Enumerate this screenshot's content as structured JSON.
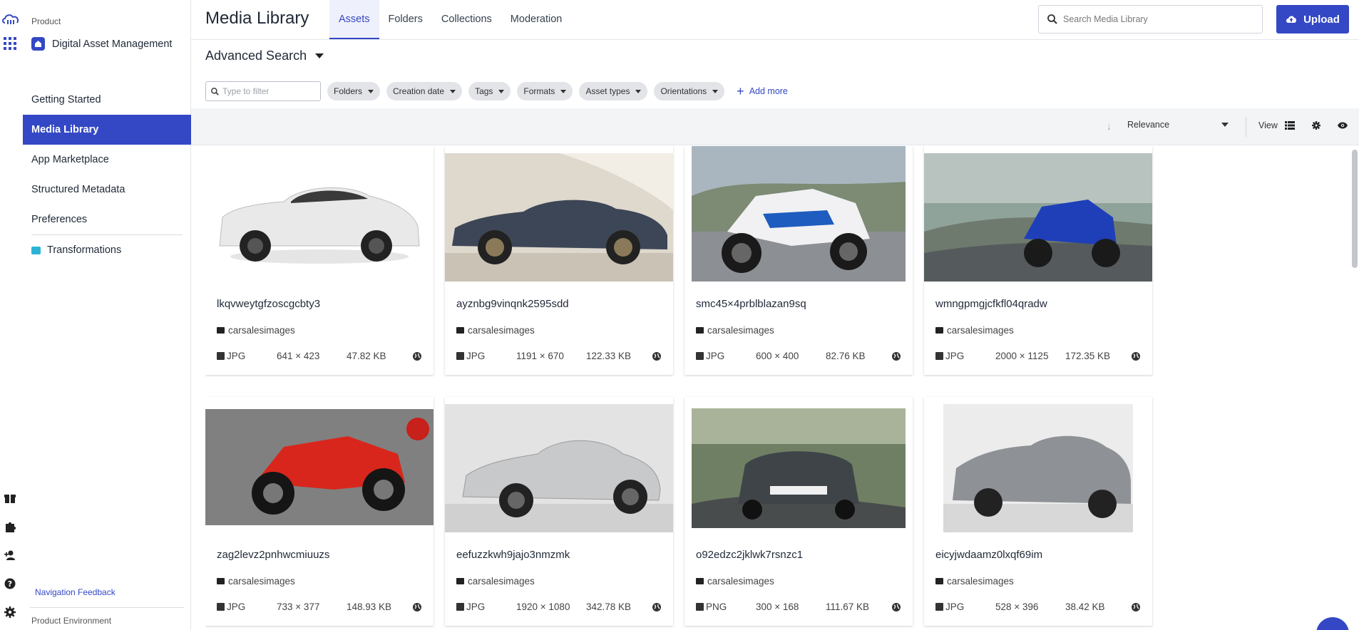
{
  "sidebar": {
    "product_label": "Product",
    "product_name": "Digital Asset Management",
    "nav": [
      "Getting Started",
      "Media Library",
      "App Marketplace",
      "Structured Metadata",
      "Preferences"
    ],
    "active_index": 1,
    "transformations": "Transformations",
    "feedback": "Navigation Feedback",
    "environment": "Product Environment"
  },
  "header": {
    "title": "Media Library",
    "tabs": [
      "Assets",
      "Folders",
      "Collections",
      "Moderation"
    ],
    "active_tab": 0,
    "search_placeholder": "Search Media Library",
    "upload_label": "Upload"
  },
  "search_bar": {
    "title": "Advanced Search",
    "filter_placeholder": "Type to filter",
    "chips": [
      "Folders",
      "Creation date",
      "Tags",
      "Formats",
      "Asset types",
      "Orientations"
    ],
    "add_more": "Add more"
  },
  "toolbar": {
    "sort": "Relevance",
    "view_label": "View"
  },
  "colors": {
    "accent": "#3448c5"
  },
  "assets": [
    {
      "name": "lkqvweytgfzoscgcbty3",
      "folder": "carsalesimages",
      "format": "JPG",
      "dims": "641 × 423",
      "size": "47.82 KB"
    },
    {
      "name": "ayznbg9vinqnk2595sdd",
      "folder": "carsalesimages",
      "format": "JPG",
      "dims": "1191 × 670",
      "size": "122.33 KB"
    },
    {
      "name": "smc45×4prblblazan9sq",
      "folder": "carsalesimages",
      "format": "JPG",
      "dims": "600 × 400",
      "size": "82.76 KB"
    },
    {
      "name": "wmngpmgjcfkfl04qradw",
      "folder": "carsalesimages",
      "format": "JPG",
      "dims": "2000 × 1125",
      "size": "172.35 KB"
    },
    {
      "name": "zag2levz2pnhwcmiuuzs",
      "folder": "carsalesimages",
      "format": "JPG",
      "dims": "733 × 377",
      "size": "148.93 KB"
    },
    {
      "name": "eefuzzkwh9jajo3nmzmk",
      "folder": "carsalesimages",
      "format": "JPG",
      "dims": "1920 × 1080",
      "size": "342.78 KB"
    },
    {
      "name": "o92edzc2jklwk7rsnzc1",
      "folder": "carsalesimages",
      "format": "PNG",
      "dims": "300 × 168",
      "size": "111.67 KB"
    },
    {
      "name": "eicyjwdaamz0lxqf69im",
      "folder": "carsalesimages",
      "format": "JPG",
      "dims": "528 × 396",
      "size": "38.42 KB"
    }
  ]
}
